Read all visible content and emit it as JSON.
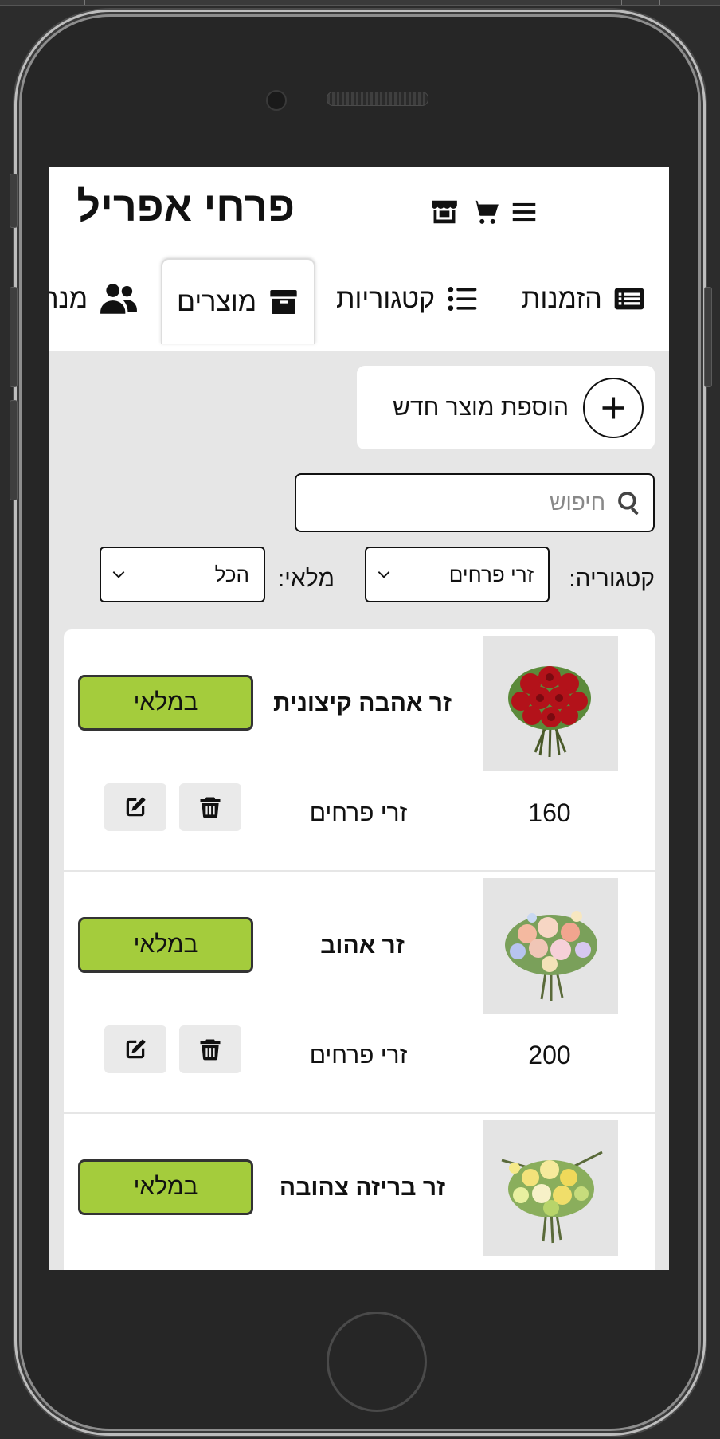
{
  "app": {
    "title": "פרחי אפריל"
  },
  "header_icons": [
    "menu-icon",
    "cart-icon",
    "store-icon"
  ],
  "nav": {
    "tabs": [
      {
        "label": "הזמנות",
        "icon": "list-alt-icon"
      },
      {
        "label": "קטגוריות",
        "icon": "list-icon"
      },
      {
        "label": "מוצרים",
        "icon": "box-icon"
      },
      {
        "label": "מנה",
        "icon": "users-icon"
      }
    ]
  },
  "add_product": {
    "label": "הוספת מוצר חדש"
  },
  "search": {
    "placeholder": "חיפוש",
    "value": ""
  },
  "filters": {
    "category_label": "קטגוריה:",
    "category_value": "זרי פרחים",
    "stock_label": "מלאי:",
    "stock_value": "הכל"
  },
  "products": [
    {
      "name": "זר אהבה קיצונית",
      "stock": "במלאי",
      "price": "160",
      "category": "זרי פרחים"
    },
    {
      "name": "זר אהוב",
      "stock": "במלאי",
      "price": "200",
      "category": "זרי פרחים"
    },
    {
      "name": "זר בריזה צהובה",
      "stock": "במלאי",
      "price": "",
      "category": ""
    }
  ],
  "colors": {
    "stock_button": "#a4cc3c",
    "screen_bg": "#e6e6e6",
    "frame": "#262626"
  }
}
